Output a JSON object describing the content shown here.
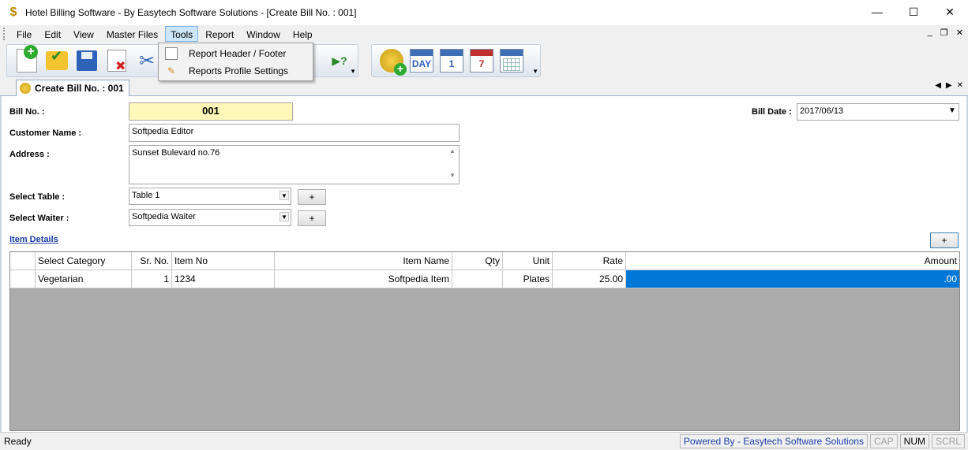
{
  "window": {
    "title": "Hotel Billing Software - By Easytech Software Solutions - [Create Bill No. : 001]",
    "minimize": "—",
    "maximize": "☐",
    "close": "✕"
  },
  "menu": {
    "items": [
      "File",
      "Edit",
      "View",
      "Master Files",
      "Tools",
      "Report",
      "Window",
      "Help"
    ],
    "open_item": "Tools",
    "mdi_minimize": "_",
    "mdi_restore": "❐",
    "mdi_close": "✕"
  },
  "tools_menu": {
    "items": [
      "Report Header / Footer",
      "Reports Profile Settings"
    ]
  },
  "toolbar": {
    "cal_day": "DAY",
    "cal_one": "1",
    "cal_seven": "7",
    "help_glyph": "▶?"
  },
  "tab": {
    "label": "Create Bill No. : 001",
    "nav_prev": "◀",
    "nav_next": "▶",
    "nav_close": "✕"
  },
  "form": {
    "bill_no_label": "Bill No. :",
    "bill_no": "001",
    "bill_date_label": "Bill Date :",
    "bill_date": "2017/06/13",
    "customer_label": "Customer Name :",
    "customer": "Softpedia Editor",
    "address_label": "Address :",
    "address": "Sunset Bulevard no.76",
    "table_label": "Select Table :",
    "table": "Table 1",
    "waiter_label": "Select Waiter :",
    "waiter": "Softpedia Waiter",
    "plus": "+",
    "item_details": "Item Details"
  },
  "grid": {
    "columns": [
      "",
      "Select Category",
      "Sr. No.",
      "Item No",
      "Item Name",
      "Qty",
      "Unit",
      "Rate",
      "Amount"
    ],
    "rows": [
      [
        "",
        "Vegetarian",
        "1",
        "1234",
        "Softpedia Item",
        "",
        "Plates",
        "25.00",
        ".00"
      ]
    ]
  },
  "status": {
    "left": "Ready",
    "powered": "Powered By - Easytech Software Solutions",
    "cap": "CAP",
    "num": "NUM",
    "scrl": "SCRL"
  }
}
